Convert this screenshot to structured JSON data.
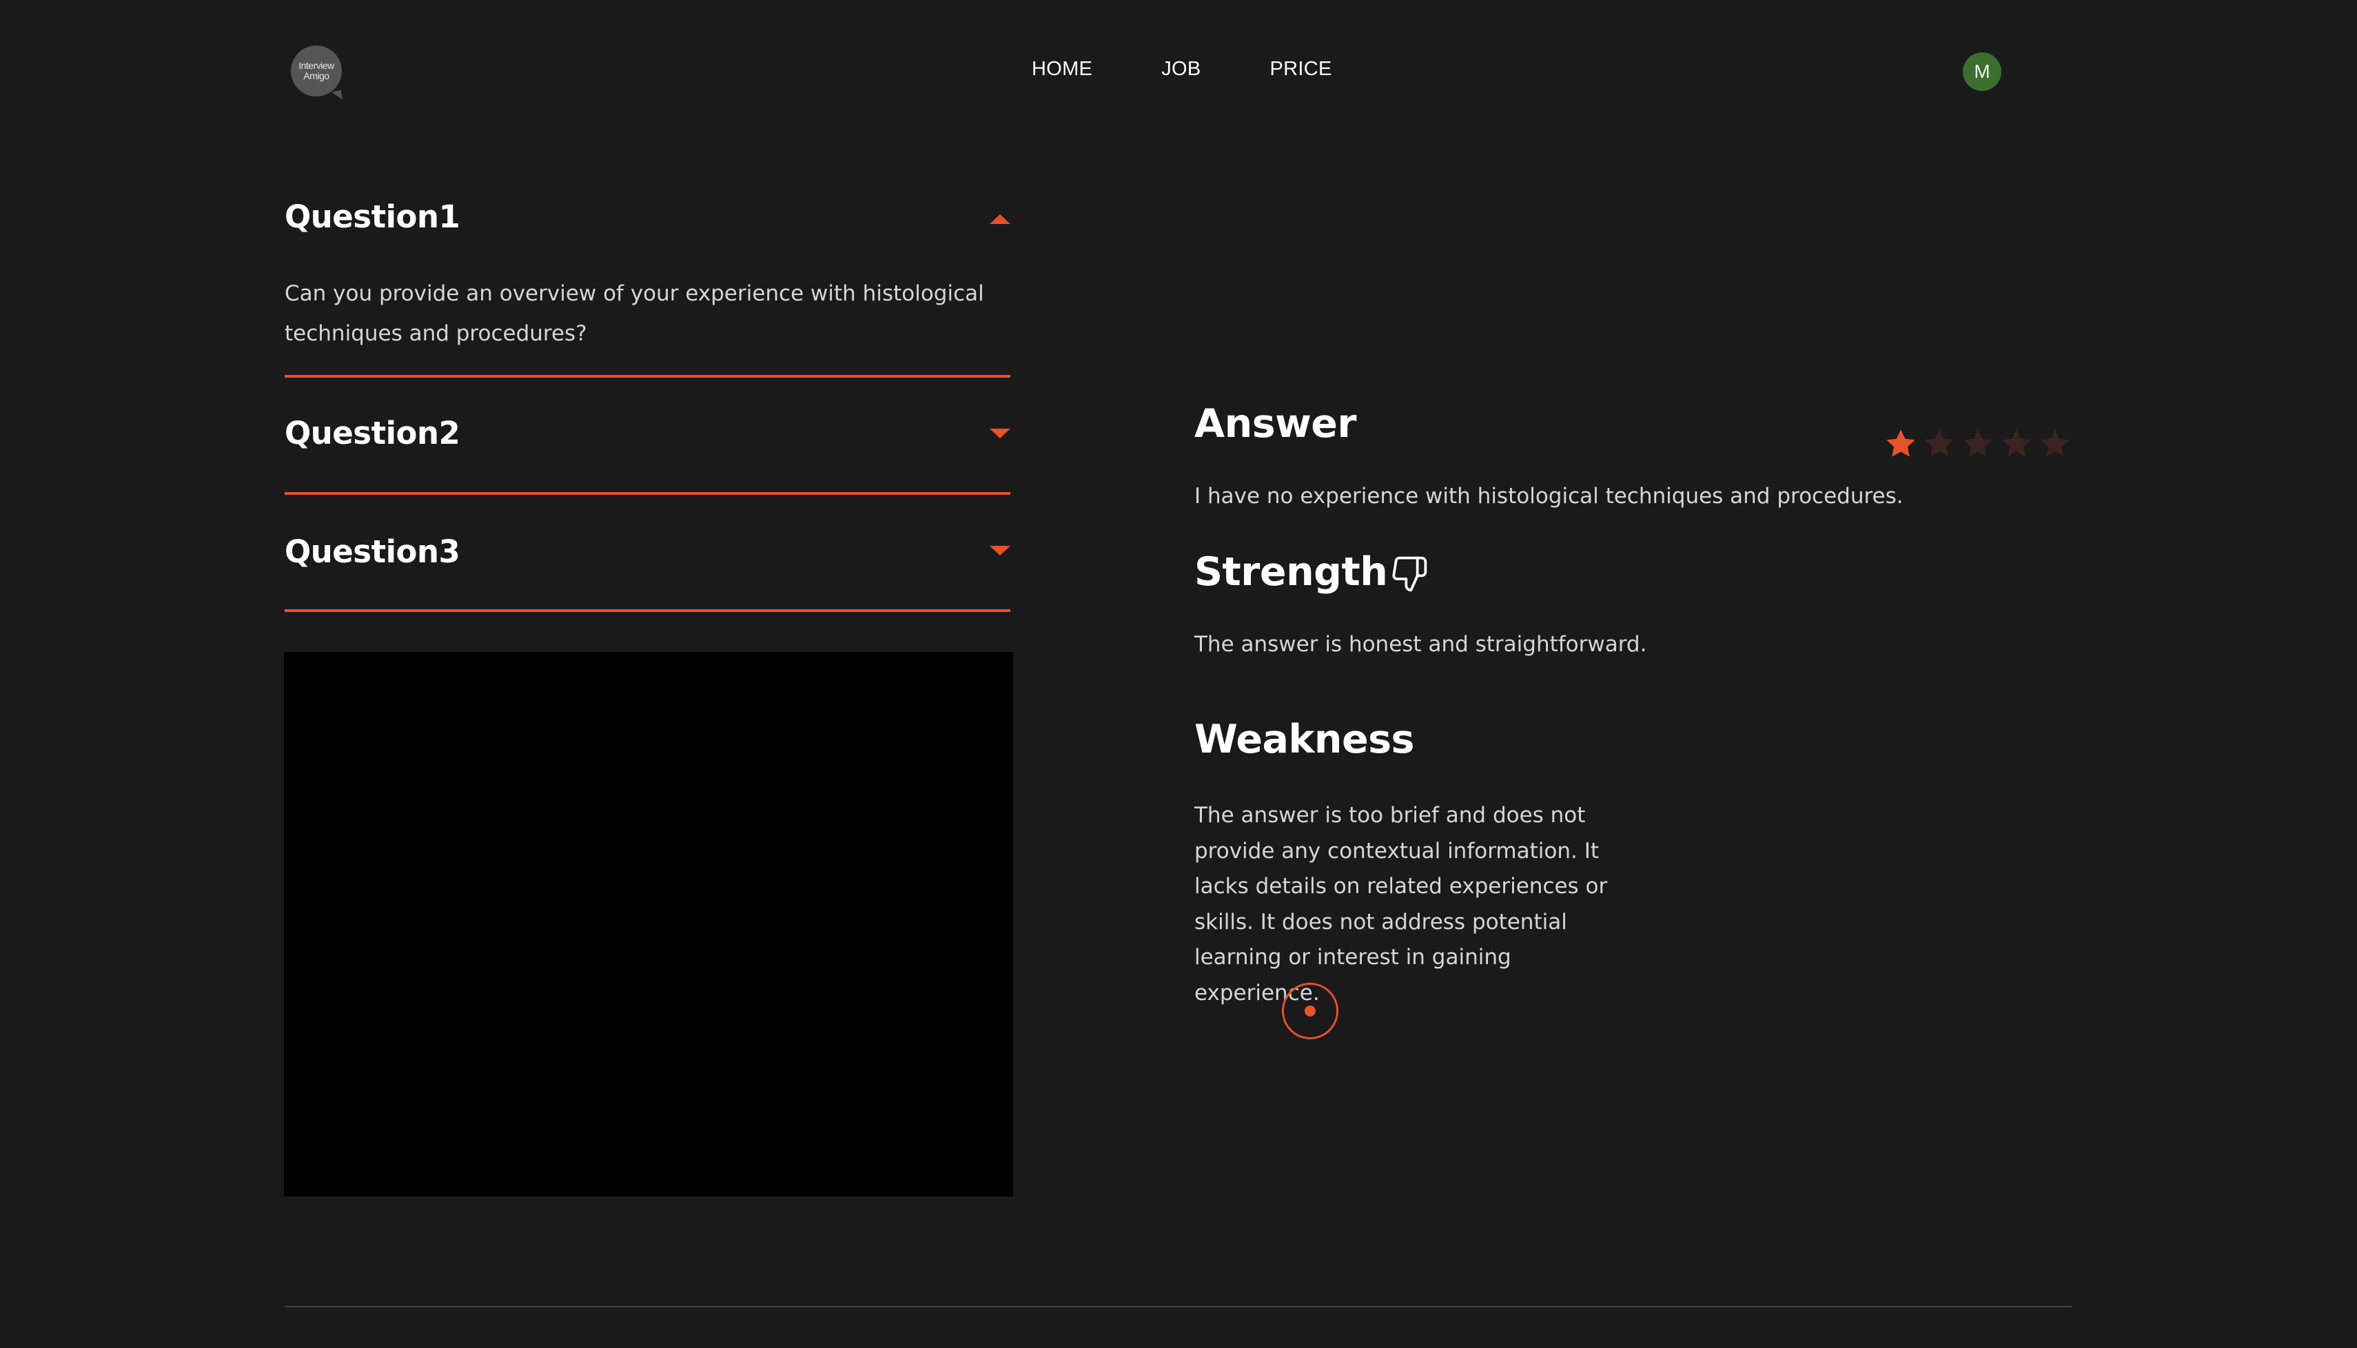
{
  "header": {
    "logo_line1": "Interview",
    "logo_line2": "Amigo",
    "nav": [
      "HOME",
      "JOB",
      "PRICE"
    ],
    "avatar_initial": "M"
  },
  "accordion": {
    "items": [
      {
        "title": "Question1",
        "expanded": true,
        "body": "Can you provide an overview of your experience with histological techniques and procedures?"
      },
      {
        "title": "Question2",
        "expanded": false
      },
      {
        "title": "Question3",
        "expanded": false
      }
    ]
  },
  "feedback": {
    "answer_title": "Answer",
    "answer_text": "I have no experience with histological techniques and procedures.",
    "strength_title": "Strength",
    "strength_text": "The answer is honest and straightforward.",
    "weakness_title": "Weakness",
    "weakness_text": "The answer is too brief and does not provide any contextual information. It lacks details on related experiences or skills. It does not address potential learning or interest in gaining experience.",
    "rating": 1,
    "rating_max": 5
  },
  "icons": {
    "strength_icon": "thumbs-down-icon",
    "caret_expanded": "caret-up-icon",
    "caret_collapsed": "caret-down-icon",
    "record": "record-icon"
  },
  "colors": {
    "background": "#1a1a1a",
    "accent": "#e8512a",
    "star_inactive": "#3a2320",
    "avatar": "#3c6e2e"
  }
}
